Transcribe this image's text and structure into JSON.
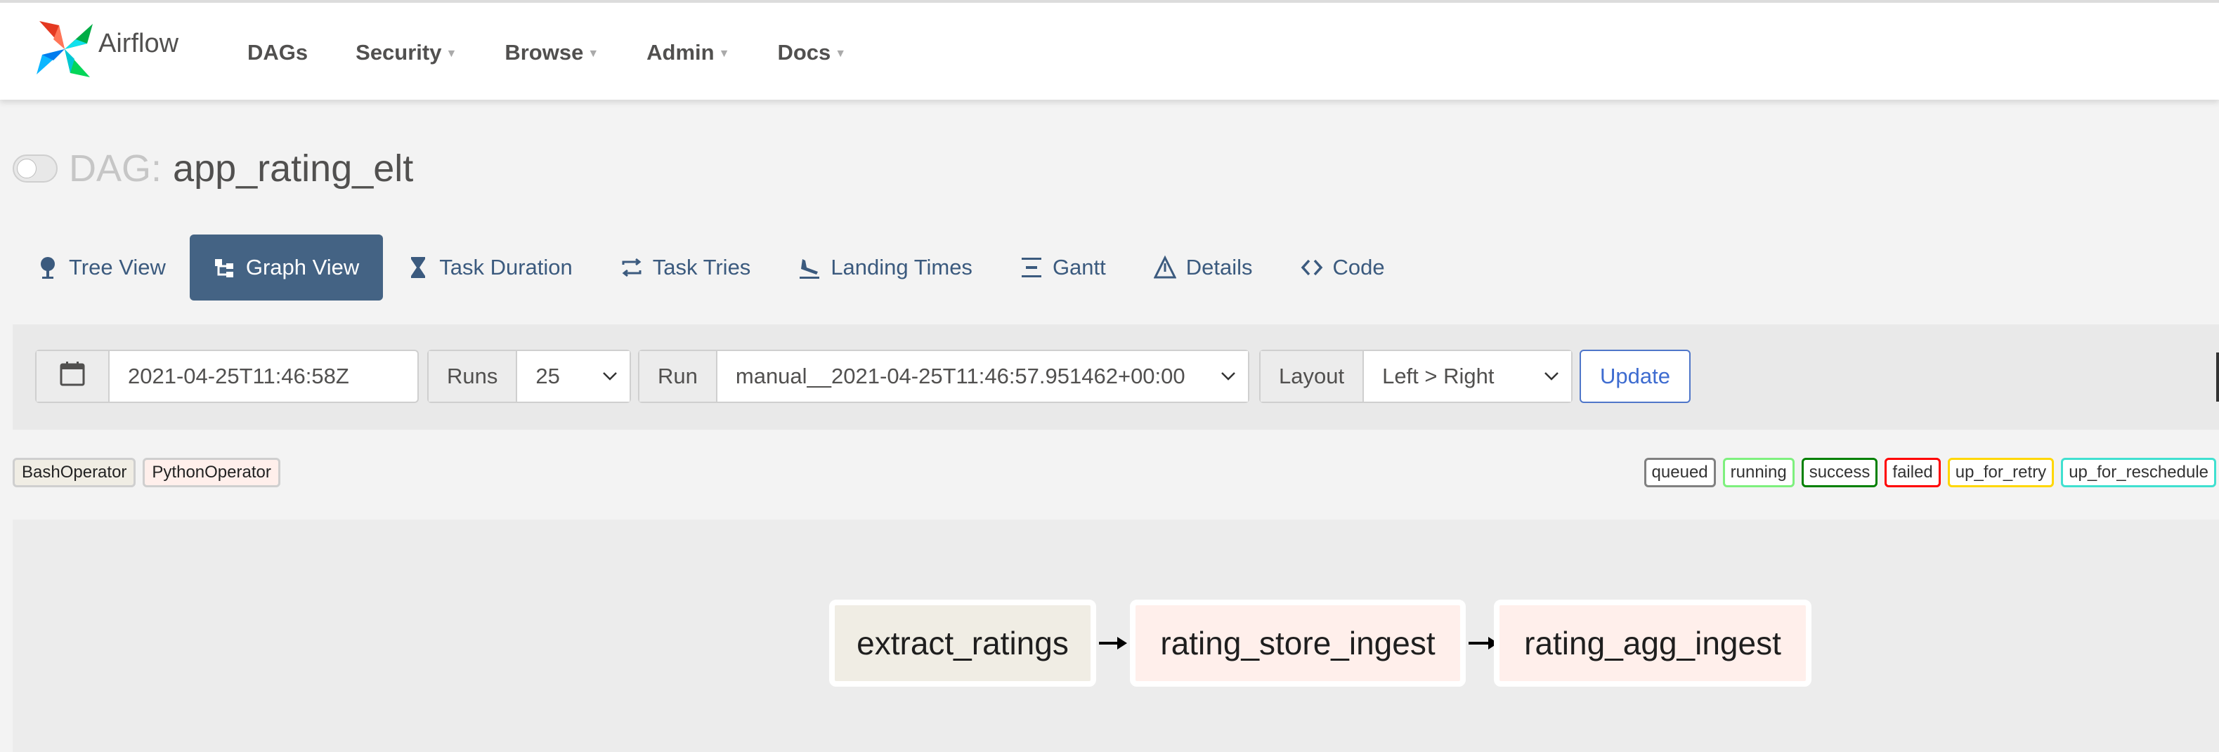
{
  "brand": {
    "name": "Airflow",
    "logo_icon": "airflow-pinwheel-icon"
  },
  "nav": [
    {
      "label": "DAGs",
      "dropdown": false
    },
    {
      "label": "Security",
      "dropdown": true
    },
    {
      "label": "Browse",
      "dropdown": true
    },
    {
      "label": "Admin",
      "dropdown": true
    },
    {
      "label": "Docs",
      "dropdown": true
    }
  ],
  "dag": {
    "prefix": "DAG:",
    "name": "app_rating_elt",
    "paused": true
  },
  "tabs": [
    {
      "label": "Tree View",
      "icon": "tree-icon",
      "active": false
    },
    {
      "label": "Graph View",
      "icon": "graph-icon",
      "active": true
    },
    {
      "label": "Task Duration",
      "icon": "hourglass-icon",
      "active": false
    },
    {
      "label": "Task Tries",
      "icon": "retry-icon",
      "active": false
    },
    {
      "label": "Landing Times",
      "icon": "plane-landing-icon",
      "active": false
    },
    {
      "label": "Gantt",
      "icon": "gantt-icon",
      "active": false
    },
    {
      "label": "Details",
      "icon": "warning-triangle-icon",
      "active": false
    },
    {
      "label": "Code",
      "icon": "code-icon",
      "active": false
    }
  ],
  "filters": {
    "date_icon": "calendar-icon",
    "date_value": "2021-04-25T11:46:58Z",
    "runs_label": "Runs",
    "runs_value": "25",
    "run_label": "Run",
    "run_value": "manual__2021-04-25T11:46:57.951462+00:00",
    "layout_label": "Layout",
    "layout_value": "Left > Right",
    "update_label": "Update"
  },
  "operator_legend": [
    {
      "label": "BashOperator",
      "bg": "#f0ede4"
    },
    {
      "label": "PythonOperator",
      "bg": "#ffefeb"
    }
  ],
  "state_legend": [
    {
      "label": "queued",
      "color": "#808080"
    },
    {
      "label": "running",
      "color": "#00ff00"
    },
    {
      "label": "success",
      "color": "#008000"
    },
    {
      "label": "failed",
      "color": "#ff0000"
    },
    {
      "label": "up_for_retry",
      "color": "#ffd700"
    },
    {
      "label": "up_for_reschedule",
      "color": "#40e0d0"
    }
  ],
  "graph": {
    "nodes": [
      {
        "label": "extract_ratings",
        "operator": "BashOperator",
        "bg": "#f0ede4"
      },
      {
        "label": "rating_store_ingest",
        "operator": "PythonOperator",
        "bg": "#ffefeb"
      },
      {
        "label": "rating_agg_ingest",
        "operator": "PythonOperator",
        "bg": "#ffefeb"
      }
    ],
    "edges": [
      {
        "from": "extract_ratings",
        "to": "rating_store_ingest"
      },
      {
        "from": "rating_store_ingest",
        "to": "rating_agg_ingest"
      }
    ]
  }
}
